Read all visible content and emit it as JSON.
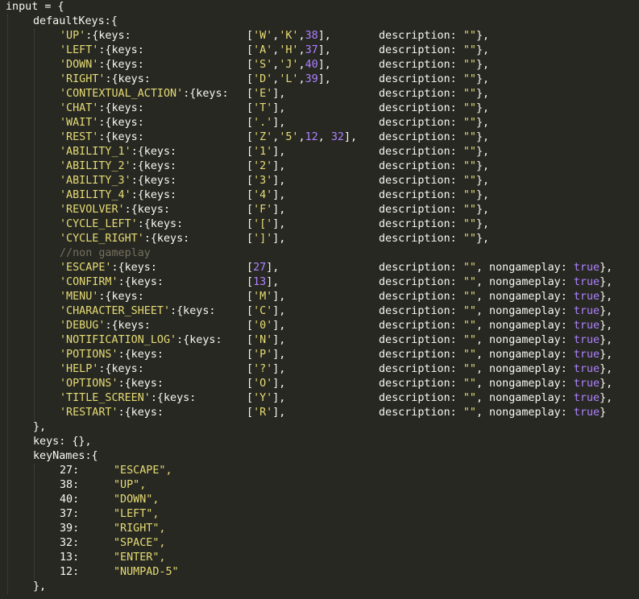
{
  "editor": {
    "theme_colors": {
      "background": "#272822",
      "text": "#f8f8f2",
      "string": "#e6db74",
      "number": "#ae81ff",
      "comment": "#75715e"
    },
    "lines": [
      [
        [
          "p",
          "input = {"
        ]
      ],
      [
        [
          "p",
          "defaultKeys:{"
        ]
      ],
      [
        [
          "s",
          "'UP'"
        ],
        [
          "p",
          ":{keys:"
        ],
        [
          "p",
          "["
        ],
        [
          "s",
          "'W'"
        ],
        [
          "p",
          ","
        ],
        [
          "s",
          "'K'"
        ],
        [
          "p",
          ","
        ],
        [
          "n",
          "38"
        ],
        [
          "p",
          "],"
        ],
        [
          "p",
          "description: "
        ],
        [
          "s",
          "\"\""
        ],
        [
          "p",
          "},"
        ]
      ],
      [
        [
          "s",
          "'LEFT'"
        ],
        [
          "p",
          ":{keys:"
        ],
        [
          "p",
          "["
        ],
        [
          "s",
          "'A'"
        ],
        [
          "p",
          ","
        ],
        [
          "s",
          "'H'"
        ],
        [
          "p",
          ","
        ],
        [
          "n",
          "37"
        ],
        [
          "p",
          "],"
        ],
        [
          "p",
          "description: "
        ],
        [
          "s",
          "\"\""
        ],
        [
          "p",
          "},"
        ]
      ],
      [
        [
          "s",
          "'DOWN'"
        ],
        [
          "p",
          ":{keys:"
        ],
        [
          "p",
          "["
        ],
        [
          "s",
          "'S'"
        ],
        [
          "p",
          ","
        ],
        [
          "s",
          "'J'"
        ],
        [
          "p",
          ","
        ],
        [
          "n",
          "40"
        ],
        [
          "p",
          "],"
        ],
        [
          "p",
          "description: "
        ],
        [
          "s",
          "\"\""
        ],
        [
          "p",
          "},"
        ]
      ],
      [
        [
          "s",
          "'RIGHT'"
        ],
        [
          "p",
          ":{keys:"
        ],
        [
          "p",
          "["
        ],
        [
          "s",
          "'D'"
        ],
        [
          "p",
          ","
        ],
        [
          "s",
          "'L'"
        ],
        [
          "p",
          ","
        ],
        [
          "n",
          "39"
        ],
        [
          "p",
          "],"
        ],
        [
          "p",
          "description: "
        ],
        [
          "s",
          "\"\""
        ],
        [
          "p",
          "},"
        ]
      ],
      [
        [
          "s",
          "'CONTEXTUAL_ACTION'"
        ],
        [
          "p",
          ":{keys:"
        ],
        [
          "p",
          "["
        ],
        [
          "s",
          "'E'"
        ],
        [
          "p",
          "],"
        ],
        [
          "p",
          "description: "
        ],
        [
          "s",
          "\"\""
        ],
        [
          "p",
          "},"
        ]
      ],
      [
        [
          "s",
          "'CHAT'"
        ],
        [
          "p",
          ":{keys:"
        ],
        [
          "p",
          "["
        ],
        [
          "s",
          "'T'"
        ],
        [
          "p",
          "],"
        ],
        [
          "p",
          "description: "
        ],
        [
          "s",
          "\"\""
        ],
        [
          "p",
          "},"
        ]
      ],
      [
        [
          "s",
          "'WAIT'"
        ],
        [
          "p",
          ":{keys:"
        ],
        [
          "p",
          "["
        ],
        [
          "s",
          "'.'"
        ],
        [
          "p",
          "],"
        ],
        [
          "p",
          "description: "
        ],
        [
          "s",
          "\"\""
        ],
        [
          "p",
          "},"
        ]
      ],
      [
        [
          "s",
          "'REST'"
        ],
        [
          "p",
          ":{keys:"
        ],
        [
          "p",
          "["
        ],
        [
          "s",
          "'Z'"
        ],
        [
          "p",
          ","
        ],
        [
          "s",
          "'5'"
        ],
        [
          "p",
          ","
        ],
        [
          "n",
          "12"
        ],
        [
          "p",
          ", "
        ],
        [
          "n",
          "32"
        ],
        [
          "p",
          "],"
        ],
        [
          "p",
          "description: "
        ],
        [
          "s",
          "\"\""
        ],
        [
          "p",
          "},"
        ]
      ],
      [
        [
          "s",
          "'ABILITY_1'"
        ],
        [
          "p",
          ":{keys:"
        ],
        [
          "p",
          "["
        ],
        [
          "s",
          "'1'"
        ],
        [
          "p",
          "],"
        ],
        [
          "p",
          "description: "
        ],
        [
          "s",
          "\"\""
        ],
        [
          "p",
          "},"
        ]
      ],
      [
        [
          "s",
          "'ABILITY_2'"
        ],
        [
          "p",
          ":{keys:"
        ],
        [
          "p",
          "["
        ],
        [
          "s",
          "'2'"
        ],
        [
          "p",
          "],"
        ],
        [
          "p",
          "description: "
        ],
        [
          "s",
          "\"\""
        ],
        [
          "p",
          "},"
        ]
      ],
      [
        [
          "s",
          "'ABILITY_3'"
        ],
        [
          "p",
          ":{keys:"
        ],
        [
          "p",
          "["
        ],
        [
          "s",
          "'3'"
        ],
        [
          "p",
          "],"
        ],
        [
          "p",
          "description: "
        ],
        [
          "s",
          "\"\""
        ],
        [
          "p",
          "},"
        ]
      ],
      [
        [
          "s",
          "'ABILITY_4'"
        ],
        [
          "p",
          ":{keys:"
        ],
        [
          "p",
          "["
        ],
        [
          "s",
          "'4'"
        ],
        [
          "p",
          "],"
        ],
        [
          "p",
          "description: "
        ],
        [
          "s",
          "\"\""
        ],
        [
          "p",
          "},"
        ]
      ],
      [
        [
          "s",
          "'REVOLVER'"
        ],
        [
          "p",
          ":{keys:"
        ],
        [
          "p",
          "["
        ],
        [
          "s",
          "'F'"
        ],
        [
          "p",
          "],"
        ],
        [
          "p",
          "description: "
        ],
        [
          "s",
          "\"\""
        ],
        [
          "p",
          "},"
        ]
      ],
      [
        [
          "s",
          "'CYCLE_LEFT'"
        ],
        [
          "p",
          ":{keys:"
        ],
        [
          "p",
          "["
        ],
        [
          "s",
          "'['"
        ],
        [
          "p",
          "],"
        ],
        [
          "p",
          "description: "
        ],
        [
          "s",
          "\"\""
        ],
        [
          "p",
          "},"
        ]
      ],
      [
        [
          "s",
          "'CYCLE_RIGHT'"
        ],
        [
          "p",
          ":{keys:"
        ],
        [
          "p",
          "["
        ],
        [
          "s",
          "']'"
        ],
        [
          "p",
          "],"
        ],
        [
          "p",
          "description: "
        ],
        [
          "s",
          "\"\""
        ],
        [
          "p",
          "},"
        ]
      ],
      [
        [
          "c",
          "//non gameplay"
        ]
      ],
      [
        [
          "s",
          "'ESCAPE'"
        ],
        [
          "p",
          ":{keys:"
        ],
        [
          "p",
          "["
        ],
        [
          "n",
          "27"
        ],
        [
          "p",
          "],"
        ],
        [
          "p",
          "description: "
        ],
        [
          "s",
          "\"\""
        ],
        [
          "p",
          ", nongameplay: "
        ],
        [
          "b",
          "true"
        ],
        [
          "p",
          "},"
        ]
      ],
      [
        [
          "s",
          "'CONFIRM'"
        ],
        [
          "p",
          ":{keys:"
        ],
        [
          "p",
          "["
        ],
        [
          "n",
          "13"
        ],
        [
          "p",
          "],"
        ],
        [
          "p",
          "description: "
        ],
        [
          "s",
          "\"\""
        ],
        [
          "p",
          ", nongameplay: "
        ],
        [
          "b",
          "true"
        ],
        [
          "p",
          "},"
        ]
      ],
      [
        [
          "s",
          "'MENU'"
        ],
        [
          "p",
          ":{keys:"
        ],
        [
          "p",
          "["
        ],
        [
          "s",
          "'M'"
        ],
        [
          "p",
          "],"
        ],
        [
          "p",
          "description: "
        ],
        [
          "s",
          "\"\""
        ],
        [
          "p",
          ", nongameplay: "
        ],
        [
          "b",
          "true"
        ],
        [
          "p",
          "},"
        ]
      ],
      [
        [
          "s",
          "'CHARACTER_SHEET'"
        ],
        [
          "p",
          ":{keys:"
        ],
        [
          "p",
          "["
        ],
        [
          "s",
          "'C'"
        ],
        [
          "p",
          "],"
        ],
        [
          "p",
          "description: "
        ],
        [
          "s",
          "\"\""
        ],
        [
          "p",
          ", nongameplay: "
        ],
        [
          "b",
          "true"
        ],
        [
          "p",
          "},"
        ]
      ],
      [
        [
          "s",
          "'DEBUG'"
        ],
        [
          "p",
          ":{keys:"
        ],
        [
          "p",
          "["
        ],
        [
          "s",
          "'0'"
        ],
        [
          "p",
          "],"
        ],
        [
          "p",
          "description: "
        ],
        [
          "s",
          "\"\""
        ],
        [
          "p",
          ", nongameplay: "
        ],
        [
          "b",
          "true"
        ],
        [
          "p",
          "},"
        ]
      ],
      [
        [
          "s",
          "'NOTIFICATION_LOG'"
        ],
        [
          "p",
          ":{keys:"
        ],
        [
          "p",
          "["
        ],
        [
          "s",
          "'N'"
        ],
        [
          "p",
          "],"
        ],
        [
          "p",
          "description: "
        ],
        [
          "s",
          "\"\""
        ],
        [
          "p",
          ", nongameplay: "
        ],
        [
          "b",
          "true"
        ],
        [
          "p",
          "},"
        ]
      ],
      [
        [
          "s",
          "'POTIONS'"
        ],
        [
          "p",
          ":{keys:"
        ],
        [
          "p",
          "["
        ],
        [
          "s",
          "'P'"
        ],
        [
          "p",
          "],"
        ],
        [
          "p",
          "description: "
        ],
        [
          "s",
          "\"\""
        ],
        [
          "p",
          ", nongameplay: "
        ],
        [
          "b",
          "true"
        ],
        [
          "p",
          "},"
        ]
      ],
      [
        [
          "s",
          "'HELP'"
        ],
        [
          "p",
          ":{keys:"
        ],
        [
          "p",
          "["
        ],
        [
          "s",
          "'?'"
        ],
        [
          "p",
          "],"
        ],
        [
          "p",
          "description: "
        ],
        [
          "s",
          "\"\""
        ],
        [
          "p",
          ", nongameplay: "
        ],
        [
          "b",
          "true"
        ],
        [
          "p",
          "},"
        ]
      ],
      [
        [
          "s",
          "'OPTIONS'"
        ],
        [
          "p",
          ":{keys:"
        ],
        [
          "p",
          "["
        ],
        [
          "s",
          "'O'"
        ],
        [
          "p",
          "],"
        ],
        [
          "p",
          "description: "
        ],
        [
          "s",
          "\"\""
        ],
        [
          "p",
          ", nongameplay: "
        ],
        [
          "b",
          "true"
        ],
        [
          "p",
          "},"
        ]
      ],
      [
        [
          "s",
          "'TITLE_SCREEN'"
        ],
        [
          "p",
          ":{keys:"
        ],
        [
          "p",
          "["
        ],
        [
          "s",
          "'Y'"
        ],
        [
          "p",
          "],"
        ],
        [
          "p",
          "description: "
        ],
        [
          "s",
          "\"\""
        ],
        [
          "p",
          ", nongameplay: "
        ],
        [
          "b",
          "true"
        ],
        [
          "p",
          "},"
        ]
      ],
      [
        [
          "s",
          "'RESTART'"
        ],
        [
          "p",
          ":{keys:"
        ],
        [
          "p",
          "["
        ],
        [
          "s",
          "'R'"
        ],
        [
          "p",
          "],"
        ],
        [
          "p",
          "description: "
        ],
        [
          "s",
          "\"\""
        ],
        [
          "p",
          ", nongameplay: "
        ],
        [
          "b",
          "true"
        ],
        [
          "p",
          "}"
        ]
      ],
      [
        [
          "p",
          "},"
        ]
      ],
      [
        [
          "p",
          "keys: {},"
        ]
      ],
      [
        [
          "p",
          "keyNames:{"
        ]
      ],
      [
        [
          "p",
          "27:"
        ],
        [
          "s",
          "\"ESCAPE\","
        ]
      ],
      [
        [
          "p",
          "38:"
        ],
        [
          "s",
          "\"UP\","
        ]
      ],
      [
        [
          "p",
          "40:"
        ],
        [
          "s",
          "\"DOWN\","
        ]
      ],
      [
        [
          "p",
          "37:"
        ],
        [
          "s",
          "\"LEFT\","
        ]
      ],
      [
        [
          "p",
          "39:"
        ],
        [
          "s",
          "\"RIGHT\","
        ]
      ],
      [
        [
          "p",
          "32:"
        ],
        [
          "s",
          "\"SPACE\","
        ]
      ],
      [
        [
          "p",
          "13:"
        ],
        [
          "s",
          "\"ENTER\","
        ]
      ],
      [
        [
          "p",
          "12:"
        ],
        [
          "s",
          "\"NUMPAD-5\""
        ]
      ],
      [
        [
          "p",
          "},"
        ]
      ]
    ]
  }
}
